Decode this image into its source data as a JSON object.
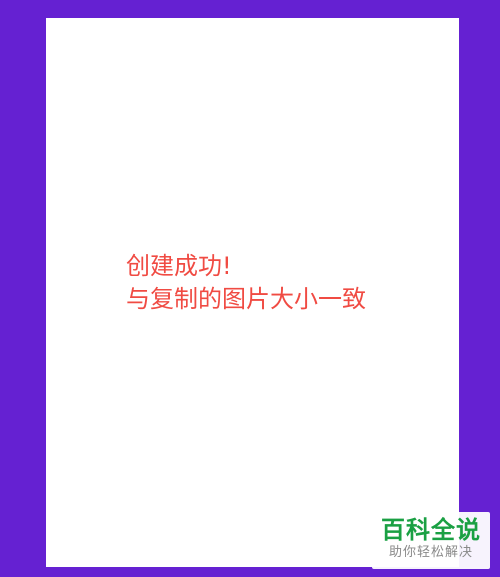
{
  "canvas": {
    "message_line1": "创建成功!",
    "message_line2": "与复制的图片大小一致"
  },
  "watermark": {
    "title": "百科全说",
    "subtitle": "助你轻松解决"
  },
  "colors": {
    "background": "#6521d2",
    "canvas": "#ffffff",
    "message_text": "#f04b43",
    "watermark_title": "#1aa043",
    "watermark_subtitle": "#8a8a8a"
  }
}
